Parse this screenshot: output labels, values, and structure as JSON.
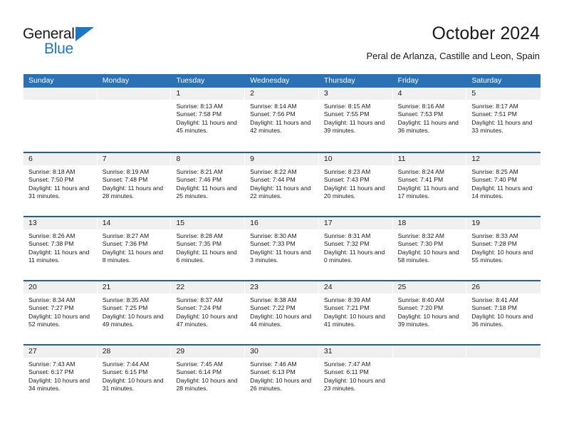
{
  "brand": {
    "name_part1": "General",
    "name_part2": "Blue",
    "accent_color": "#1f77bd"
  },
  "header": {
    "title": "October 2024",
    "subtitle": "Peral de Arlanza, Castille and Leon, Spain"
  },
  "theme": {
    "header_blue": "#2a72b5",
    "week_divider_blue": "#1f5fa3",
    "daynum_band": "#f0f0f0",
    "text": "#1a1a1a"
  },
  "calendar": {
    "day_headers": [
      "Sunday",
      "Monday",
      "Tuesday",
      "Wednesday",
      "Thursday",
      "Friday",
      "Saturday"
    ],
    "weeks": [
      [
        {
          "day": "",
          "empty": true
        },
        {
          "day": "",
          "empty": true
        },
        {
          "day": "1",
          "sunrise": "Sunrise: 8:13 AM",
          "sunset": "Sunset: 7:58 PM",
          "daylight": "Daylight: 11 hours and 45 minutes."
        },
        {
          "day": "2",
          "sunrise": "Sunrise: 8:14 AM",
          "sunset": "Sunset: 7:56 PM",
          "daylight": "Daylight: 11 hours and 42 minutes."
        },
        {
          "day": "3",
          "sunrise": "Sunrise: 8:15 AM",
          "sunset": "Sunset: 7:55 PM",
          "daylight": "Daylight: 11 hours and 39 minutes."
        },
        {
          "day": "4",
          "sunrise": "Sunrise: 8:16 AM",
          "sunset": "Sunset: 7:53 PM",
          "daylight": "Daylight: 11 hours and 36 minutes."
        },
        {
          "day": "5",
          "sunrise": "Sunrise: 8:17 AM",
          "sunset": "Sunset: 7:51 PM",
          "daylight": "Daylight: 11 hours and 33 minutes."
        }
      ],
      [
        {
          "day": "6",
          "sunrise": "Sunrise: 8:18 AM",
          "sunset": "Sunset: 7:50 PM",
          "daylight": "Daylight: 11 hours and 31 minutes."
        },
        {
          "day": "7",
          "sunrise": "Sunrise: 8:19 AM",
          "sunset": "Sunset: 7:48 PM",
          "daylight": "Daylight: 11 hours and 28 minutes."
        },
        {
          "day": "8",
          "sunrise": "Sunrise: 8:21 AM",
          "sunset": "Sunset: 7:46 PM",
          "daylight": "Daylight: 11 hours and 25 minutes."
        },
        {
          "day": "9",
          "sunrise": "Sunrise: 8:22 AM",
          "sunset": "Sunset: 7:44 PM",
          "daylight": "Daylight: 11 hours and 22 minutes."
        },
        {
          "day": "10",
          "sunrise": "Sunrise: 8:23 AM",
          "sunset": "Sunset: 7:43 PM",
          "daylight": "Daylight: 11 hours and 20 minutes."
        },
        {
          "day": "11",
          "sunrise": "Sunrise: 8:24 AM",
          "sunset": "Sunset: 7:41 PM",
          "daylight": "Daylight: 11 hours and 17 minutes."
        },
        {
          "day": "12",
          "sunrise": "Sunrise: 8:25 AM",
          "sunset": "Sunset: 7:40 PM",
          "daylight": "Daylight: 11 hours and 14 minutes."
        }
      ],
      [
        {
          "day": "13",
          "sunrise": "Sunrise: 8:26 AM",
          "sunset": "Sunset: 7:38 PM",
          "daylight": "Daylight: 11 hours and 11 minutes."
        },
        {
          "day": "14",
          "sunrise": "Sunrise: 8:27 AM",
          "sunset": "Sunset: 7:36 PM",
          "daylight": "Daylight: 11 hours and 8 minutes."
        },
        {
          "day": "15",
          "sunrise": "Sunrise: 8:28 AM",
          "sunset": "Sunset: 7:35 PM",
          "daylight": "Daylight: 11 hours and 6 minutes."
        },
        {
          "day": "16",
          "sunrise": "Sunrise: 8:30 AM",
          "sunset": "Sunset: 7:33 PM",
          "daylight": "Daylight: 11 hours and 3 minutes."
        },
        {
          "day": "17",
          "sunrise": "Sunrise: 8:31 AM",
          "sunset": "Sunset: 7:32 PM",
          "daylight": "Daylight: 11 hours and 0 minutes."
        },
        {
          "day": "18",
          "sunrise": "Sunrise: 8:32 AM",
          "sunset": "Sunset: 7:30 PM",
          "daylight": "Daylight: 10 hours and 58 minutes."
        },
        {
          "day": "19",
          "sunrise": "Sunrise: 8:33 AM",
          "sunset": "Sunset: 7:28 PM",
          "daylight": "Daylight: 10 hours and 55 minutes."
        }
      ],
      [
        {
          "day": "20",
          "sunrise": "Sunrise: 8:34 AM",
          "sunset": "Sunset: 7:27 PM",
          "daylight": "Daylight: 10 hours and 52 minutes."
        },
        {
          "day": "21",
          "sunrise": "Sunrise: 8:35 AM",
          "sunset": "Sunset: 7:25 PM",
          "daylight": "Daylight: 10 hours and 49 minutes."
        },
        {
          "day": "22",
          "sunrise": "Sunrise: 8:37 AM",
          "sunset": "Sunset: 7:24 PM",
          "daylight": "Daylight: 10 hours and 47 minutes."
        },
        {
          "day": "23",
          "sunrise": "Sunrise: 8:38 AM",
          "sunset": "Sunset: 7:22 PM",
          "daylight": "Daylight: 10 hours and 44 minutes."
        },
        {
          "day": "24",
          "sunrise": "Sunrise: 8:39 AM",
          "sunset": "Sunset: 7:21 PM",
          "daylight": "Daylight: 10 hours and 41 minutes."
        },
        {
          "day": "25",
          "sunrise": "Sunrise: 8:40 AM",
          "sunset": "Sunset: 7:20 PM",
          "daylight": "Daylight: 10 hours and 39 minutes."
        },
        {
          "day": "26",
          "sunrise": "Sunrise: 8:41 AM",
          "sunset": "Sunset: 7:18 PM",
          "daylight": "Daylight: 10 hours and 36 minutes."
        }
      ],
      [
        {
          "day": "27",
          "sunrise": "Sunrise: 7:43 AM",
          "sunset": "Sunset: 6:17 PM",
          "daylight": "Daylight: 10 hours and 34 minutes."
        },
        {
          "day": "28",
          "sunrise": "Sunrise: 7:44 AM",
          "sunset": "Sunset: 6:15 PM",
          "daylight": "Daylight: 10 hours and 31 minutes."
        },
        {
          "day": "29",
          "sunrise": "Sunrise: 7:45 AM",
          "sunset": "Sunset: 6:14 PM",
          "daylight": "Daylight: 10 hours and 28 minutes."
        },
        {
          "day": "30",
          "sunrise": "Sunrise: 7:46 AM",
          "sunset": "Sunset: 6:13 PM",
          "daylight": "Daylight: 10 hours and 26 minutes."
        },
        {
          "day": "31",
          "sunrise": "Sunrise: 7:47 AM",
          "sunset": "Sunset: 6:11 PM",
          "daylight": "Daylight: 10 hours and 23 minutes."
        },
        {
          "day": "",
          "empty": true
        },
        {
          "day": "",
          "empty": true
        }
      ]
    ]
  }
}
